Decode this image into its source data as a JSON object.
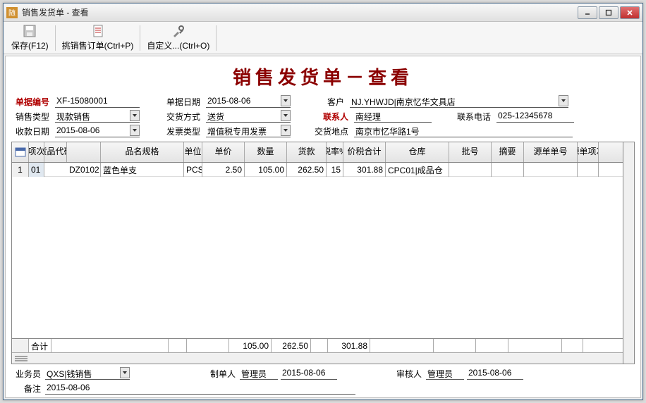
{
  "window": {
    "title": "销售发货单 - 查看"
  },
  "toolbar": {
    "save": "保存(F12)",
    "pick": "挑销售订单(Ctrl+P)",
    "custom": "自定义...(Ctrl+O)"
  },
  "doc": {
    "title": "销售发货单－查看"
  },
  "header": {
    "no_label": "单据编号",
    "no": "XF-15080001",
    "date_label": "单据日期",
    "date": "2015-08-06",
    "cust_label": "客户",
    "cust": "NJ.YHWJD|南京忆华文具店",
    "saletype_label": "销售类型",
    "saletype": "现款销售",
    "delivery_label": "交货方式",
    "delivery": "送货",
    "contact_label": "联系人",
    "contact": "南经理",
    "phone_label": "联系电话",
    "phone": "025-12345678",
    "recv_date_label": "收款日期",
    "recv_date": "2015-08-06",
    "inv_label": "发票类型",
    "inv": "增值税专用发票",
    "addr_label": "交货地点",
    "addr": "南京市忆华路1号"
  },
  "columns": {
    "seq": "项次",
    "code": "货品代码",
    "name": "品名规格",
    "unit": "单位",
    "price": "单价",
    "qty": "数量",
    "amt": "货款",
    "tax": "税率%",
    "total": "价税合计",
    "wh": "仓库",
    "batch": "批号",
    "memo": "摘要",
    "srcno": "源单单号",
    "srcseq": "源单项次"
  },
  "rows": [
    {
      "rn": "1",
      "seq": "01",
      "code": "DZ0102",
      "name": "蓝色单支",
      "unit": "PCS",
      "price": "2.50",
      "qty": "105.00",
      "amt": "262.50",
      "tax": "15",
      "total": "301.88",
      "wh": "CPC01|成品仓",
      "batch": "",
      "memo": "",
      "srcno": "",
      "srcseq": ""
    }
  ],
  "totals": {
    "label": "合计",
    "qty": "105.00",
    "amt": "262.50",
    "total": "301.88"
  },
  "footer": {
    "sales_label": "业务员",
    "sales": "QXS|钱销售",
    "maker_label": "制单人",
    "maker": "管理员",
    "maker_date": "2015-08-06",
    "checker_label": "审核人",
    "checker": "管理员",
    "checker_date": "2015-08-06",
    "remark_label": "备注",
    "remark": "2015-08-06"
  }
}
